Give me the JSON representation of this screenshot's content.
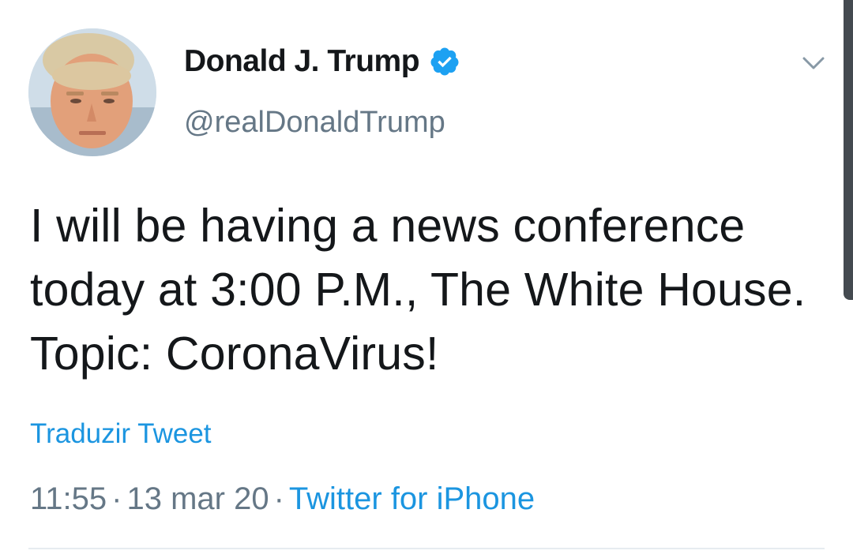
{
  "tweet": {
    "author": {
      "display_name": "Donald J. Trump",
      "handle": "@realDonaldTrump",
      "verified": true
    },
    "text": "I will be having a news conference today at 3:00 P.M., The White House. Topic: CoronaVirus!",
    "translate_label": "Traduzir Tweet",
    "time": "11:55",
    "separator": "·",
    "date": "13 mar 20",
    "source": "Twitter for iPhone"
  },
  "icons": {
    "verified": "verified-badge-icon",
    "menu": "chevron-down-icon"
  },
  "colors": {
    "text": "#14171a",
    "secondary": "#657786",
    "link": "#1b95e0",
    "verified": "#1da1f2",
    "divider": "#e6ecf0"
  }
}
